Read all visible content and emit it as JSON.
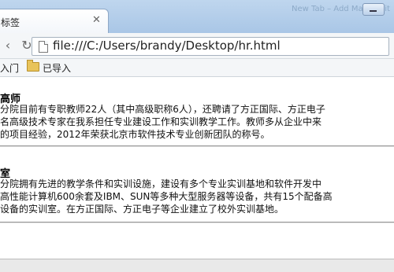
{
  "browser": {
    "tab_title": "标签",
    "ghost_text": "New Tab – Add Mark Visit",
    "url": "file:///C:/Users/brandy/Desktop/hr.html",
    "bookmarks": [
      "入门",
      "已导入"
    ]
  },
  "page": {
    "sections": [
      {
        "heading": "高师",
        "lines": [
          "分院目前有专职教师22人（其中高级职称6人），还聘请了方正国际、方正电子",
          "名高级技术专家在我系担任专业建设工作和实训教学工作。教师多从企业中来",
          "的项目经验，2012年荣获北京市软件技术专业创新团队的称号。"
        ]
      },
      {
        "heading": "室",
        "lines": [
          "分院拥有先进的教学条件和实训设施，建设有多个专业实训基地和软件开发中",
          "高性能计算机600余套及IBM、SUN等多种大型服务器等设备，共有15个配备高",
          "设备的实训室。在方正国际、方正电子等企业建立了校外实训基地。"
        ]
      }
    ]
  }
}
